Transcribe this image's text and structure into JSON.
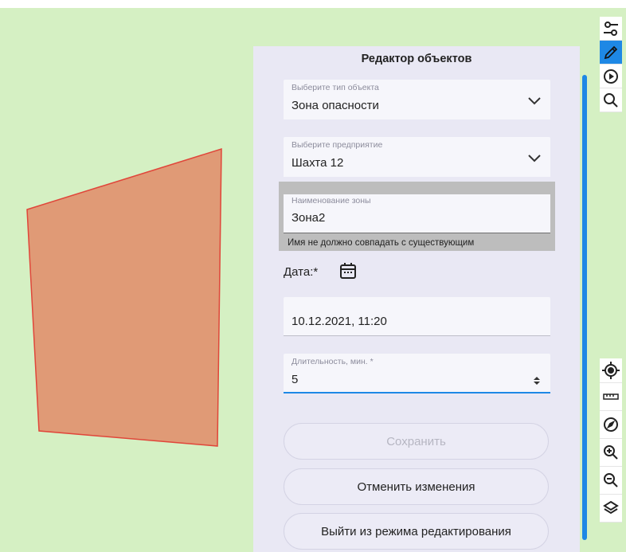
{
  "panel": {
    "title": "Редактор объектов",
    "object_type": {
      "label": "Выберите тип объекта",
      "value": "Зона опасности"
    },
    "enterprise": {
      "label": "Выберите предприятие",
      "value": "Шахта 12"
    },
    "zone_name": {
      "label": "Наименование зоны",
      "value": "Зона2",
      "hint": "Имя не должно совпадать с существующим"
    },
    "date_label": "Дата:*",
    "date_value": "10.12.2021, 11:20",
    "duration": {
      "label": "Длительность, мин. *",
      "value": "5"
    },
    "buttons": {
      "save": "Сохранить",
      "cancel": "Отменить изменения",
      "exit": "Выйти из режима редактирования"
    }
  },
  "colors": {
    "map_background": "#d5f0c3",
    "zone_fill": "#e09a76",
    "zone_stroke": "#e0463a",
    "accent": "#1e88e5",
    "panel_background": "#e9e8f4"
  },
  "toolbar_top": [
    "filter-sliders-icon",
    "pencil-icon",
    "play-circle-icon",
    "search-icon"
  ],
  "toolbar_bottom": [
    "locate-icon",
    "ruler-icon",
    "compass-icon",
    "zoom-in-icon",
    "zoom-out-icon",
    "layers-icon"
  ]
}
